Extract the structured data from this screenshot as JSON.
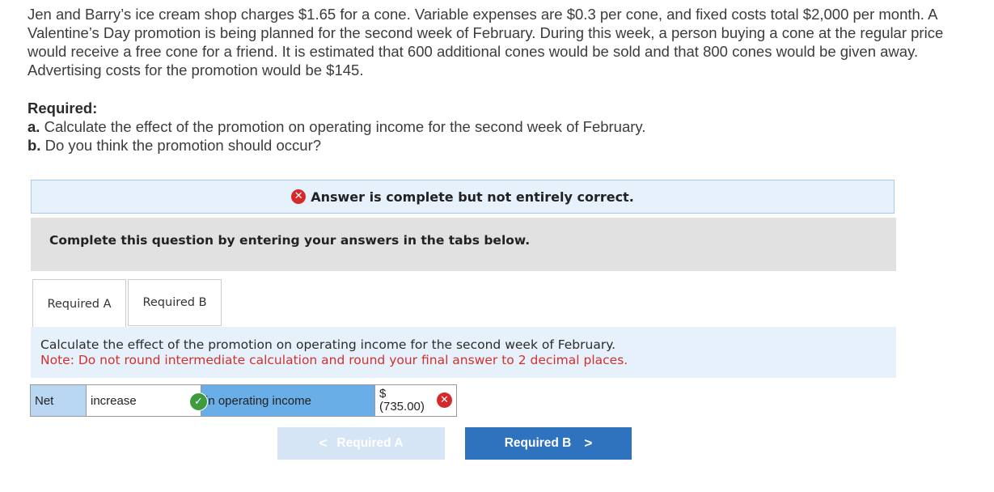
{
  "problem": {
    "text": "Jen and Barry’s ice cream shop charges $1.65 for a cone. Variable expenses are $0.3 per cone, and fixed costs total $2,000 per month. A Valentine’s Day promotion is being planned for the second week of February. During this week, a person buying a cone at the regular price would receive a free cone for a friend. It is estimated that 600 additional cones would be sold and that 800 cones would be given away. Advertising costs for the promotion would be $145."
  },
  "required": {
    "heading": "Required:",
    "a_label": "a.",
    "a_text": "Calculate the effect of the promotion on operating income for the second week of February.",
    "b_label": "b.",
    "b_text": "Do you think the promotion should occur?"
  },
  "banner": {
    "icon": "x-circle-icon",
    "text": "Answer is complete but not entirely correct."
  },
  "instructions": {
    "text": "Complete this question by entering your answers in the tabs below."
  },
  "tabs": [
    {
      "label": "Required A",
      "active": true
    },
    {
      "label": "Required B",
      "active": false
    }
  ],
  "panel": {
    "instruction": "Calculate the effect of the promotion on operating income for the second week of February.",
    "note": "Note: Do not round intermediate calculation and round your final answer to 2 decimal places."
  },
  "answer": {
    "net_label": "Net",
    "dropdown_value": "increase",
    "dropdown_status": "correct",
    "label": "in operating income",
    "currency": "$",
    "amount": "(735.00)",
    "amount_status": "incorrect"
  },
  "nav": {
    "prev_label": "Required A",
    "next_label": "Required B",
    "prev_chevron": "<",
    "next_chevron": ">"
  },
  "colors": {
    "error": "#d62a2a",
    "correct": "#3e9b3e",
    "primary_button": "#2f72bd",
    "note_text": "#d0312d"
  }
}
